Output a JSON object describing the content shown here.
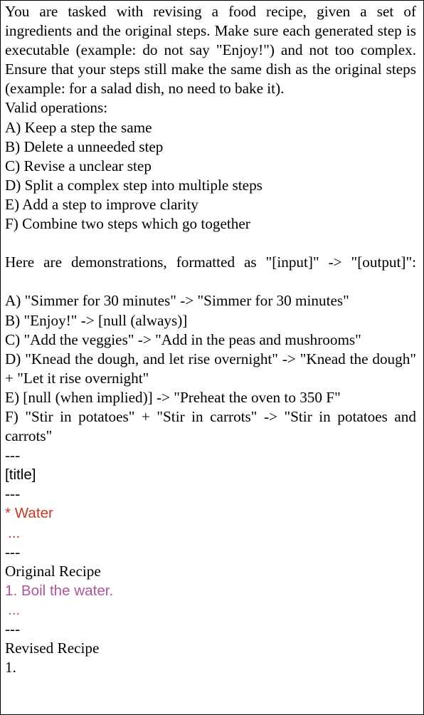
{
  "document": {
    "kind": "prompt-template-figure",
    "border_color": "#000000",
    "background_color": "#ffffff",
    "text_color": "#000000",
    "ingredient_color": "#c0392b",
    "step_color": "#b0549a"
  },
  "intro": {
    "paragraph": "You are tasked with revising a food recipe, given a set of ingredients and the original steps.  Make sure each generated step is executable (example:  do not say \"Enjoy!\") and not too complex. Ensure that your steps still make the same dish as the original steps (example: for a salad dish, no need to bake it).",
    "operations_heading": "Valid operations:"
  },
  "operations": [
    "A) Keep a step the same",
    "B) Delete a unneeded step",
    "C) Revise a unclear step",
    "D) Split a complex step into multiple steps",
    "E) Add a step to improve clarity",
    "F) Combine two steps which go together"
  ],
  "demonstrations": {
    "intro": "Here are demonstrations,  formatted  as  \"[input]\"  -> \"[output]\":",
    "items": [
      "A) \"Simmer for 30 minutes\" -> \"Simmer for 30 minutes\"",
      "B) \"Enjoy!\" -> [null (always)]",
      "C) \"Add the veggies\" -> \"Add in the peas and mushrooms\"",
      "D) \"Knead the dough, and let rise overnight\" -> \"Knead the dough\" + \"Let it rise overnight\"",
      "E) [null (when implied)] -> \"Preheat the oven to 350 F\"",
      "F) \"Stir in potatoes\" + \"Stir in carrots\" -> \"Stir in potatoes and carrots\""
    ]
  },
  "template": {
    "separator": "---",
    "title_slot": "[title]",
    "ingredients": {
      "first": "* Water",
      "more": "..."
    },
    "original_recipe": {
      "heading": "Original Recipe",
      "first_step": "1. Boil the water.",
      "more": "..."
    },
    "revised_recipe": {
      "heading": "Revised Recipe",
      "first_step": "1."
    }
  }
}
